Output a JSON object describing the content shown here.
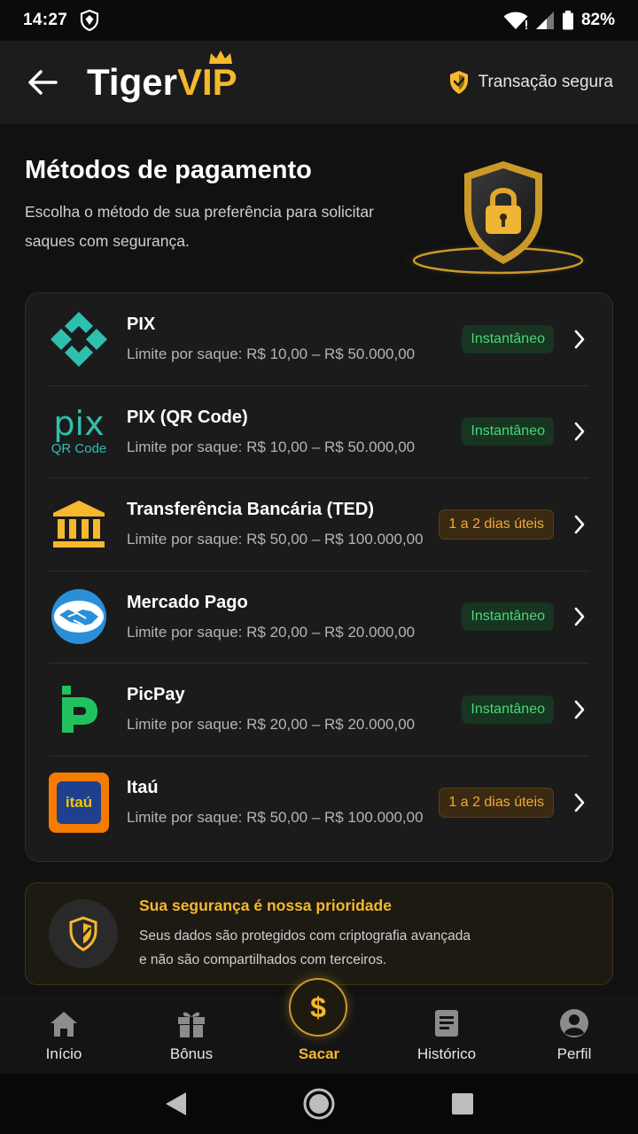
{
  "status_bar": {
    "time": "14:27",
    "battery": "82%"
  },
  "header": {
    "logo_tiger": "Tiger",
    "logo_vip": "VIP",
    "secure_label": "Transação segura"
  },
  "hero": {
    "title": "Métodos de pagamento",
    "subtitle_line1": "Escolha o método de sua preferência para solicitar",
    "subtitle_line2": "saques com segurança."
  },
  "methods": [
    {
      "name": "PIX",
      "limit": "Limite por saque: R$ 10,00 – R$ 50.000,00",
      "badge": "Instantâneo",
      "badge_type": "green"
    },
    {
      "name": "PIX (QR Code)",
      "limit": "Limite por saque: R$ 10,00 – R$ 50.000,00",
      "badge": "Instantâneo",
      "badge_type": "green",
      "icon_text_top": "pix",
      "icon_text_bottom": "QR Code"
    },
    {
      "name": "Transferência Bancária (TED)",
      "limit": "Limite por saque: R$ 50,00 – R$ 100.000,00",
      "badge": "1 a 2 dias úteis",
      "badge_type": "amber"
    },
    {
      "name": "Mercado Pago",
      "limit": "Limite por saque: R$ 20,00 – R$ 20.000,00",
      "badge": "Instantâneo",
      "badge_type": "green"
    },
    {
      "name": "PicPay",
      "limit": "Limite por saque: R$ 20,00 – R$ 20.000,00",
      "badge": "Instantâneo",
      "badge_type": "green"
    },
    {
      "name": "Itaú",
      "limit": "Limite por saque: R$ 50,00 – R$ 100.000,00",
      "badge": "1 a 2 dias úteis",
      "badge_type": "amber",
      "icon_text": "itaú"
    }
  ],
  "security": {
    "title": "Sua segurança é nossa prioridade",
    "desc_line1": "Seus dados são protegidos com criptografia avançada",
    "desc_line2": "e não são compartilhados com terceiros."
  },
  "bottom_nav": [
    {
      "label": "Início",
      "icon": "home-icon"
    },
    {
      "label": "Bônus",
      "icon": "gift-icon"
    },
    {
      "label": "Sacar",
      "icon": "dollar-icon",
      "active": true
    },
    {
      "label": "Histórico",
      "icon": "history-icon"
    },
    {
      "label": "Perfil",
      "icon": "profile-icon"
    }
  ],
  "colors": {
    "accent": "#f5b82e",
    "background": "#111111",
    "green": "#4ad67a",
    "amber": "#f0a93a"
  }
}
